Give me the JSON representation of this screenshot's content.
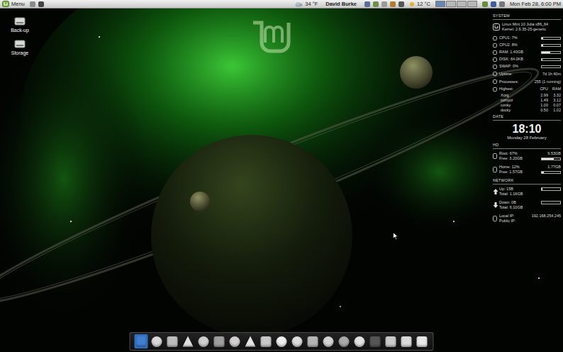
{
  "panel": {
    "menu_label": "Menu",
    "weather_temp": "34 °F",
    "user": "David Burke",
    "temp": "12 °C",
    "clock": "Mon Feb 28, 6:00 PM",
    "workspaces": [
      {
        "selected": true
      },
      {
        "selected": false
      },
      {
        "selected": false
      },
      {
        "selected": false
      }
    ]
  },
  "desktop_icons": [
    {
      "label": "Back-up"
    },
    {
      "label": "Storage"
    }
  ],
  "conky": {
    "system": {
      "title": "SYSTEM",
      "distro": "Linux Mint 10 Julia x86_64",
      "kernel": "Kernel: 2.6.35-25-generic"
    },
    "meters": [
      {
        "label": "CPU1: 7%",
        "level": 0.07
      },
      {
        "label": "CPU2: 8%",
        "level": 0.08
      },
      {
        "label": "RAM: 1.40GB",
        "level": 0.45
      },
      {
        "label": "DISK: 64.0KB",
        "level": 0.05
      },
      {
        "label": "SWAP: 0%",
        "level": 0
      }
    ],
    "stats": [
      {
        "label": "Uptime:",
        "value": "7d 1h 40m"
      },
      {
        "label": "Processes:",
        "value": "255 (1 running)"
      }
    ],
    "top": {
      "label": "Highest:",
      "columns": [
        "CPU",
        "RAM"
      ],
      "rows": [
        {
          "name": "Xorg",
          "cpu": "2.99",
          "ram": "3.32"
        },
        {
          "name": "compiz",
          "cpu": "1.49",
          "ram": "3.12"
        },
        {
          "name": "conky",
          "cpu": "1.00",
          "ram": "0.07"
        },
        {
          "name": "docky",
          "cpu": "0.50",
          "ram": "1.02"
        }
      ]
    },
    "date": {
      "title": "DATE",
      "time": "18:10",
      "date": "Monday 28 February"
    },
    "hd": {
      "title": "HD",
      "disks": [
        {
          "used": "Root: 67%",
          "size": "9.53GB",
          "free": "Free: 3.20GB",
          "level": 0.67
        },
        {
          "used": "Home: 12%",
          "size": "1.77GB",
          "free": "Free: 1.57GB",
          "level": 0.12
        }
      ]
    },
    "network": {
      "title": "NETWORK",
      "links": [
        {
          "kind": "up",
          "rate": "Up: 15B",
          "total": "Total: 1.16GB",
          "level": 0.03
        },
        {
          "kind": "down",
          "rate": "Down: 0B",
          "total": "Total: 6.10GB",
          "level": 0
        }
      ],
      "local_ip_label": "Local IP:",
      "local_ip": "192.168.254.245",
      "public_ip_label": "Public IP:"
    }
  },
  "dock": {
    "items": [
      {
        "selected": true
      },
      {
        "selected": false
      },
      {
        "selected": false
      },
      {
        "selected": false
      },
      {
        "selected": false
      },
      {
        "selected": false
      },
      {
        "selected": false
      },
      {
        "selected": false
      },
      {
        "selected": false
      },
      {
        "selected": false
      },
      {
        "selected": false
      },
      {
        "selected": false
      },
      {
        "selected": false
      },
      {
        "selected": false
      },
      {
        "selected": false
      },
      {
        "selected": false
      },
      {
        "selected": false
      },
      {
        "selected": false
      },
      {
        "selected": false
      }
    ]
  }
}
